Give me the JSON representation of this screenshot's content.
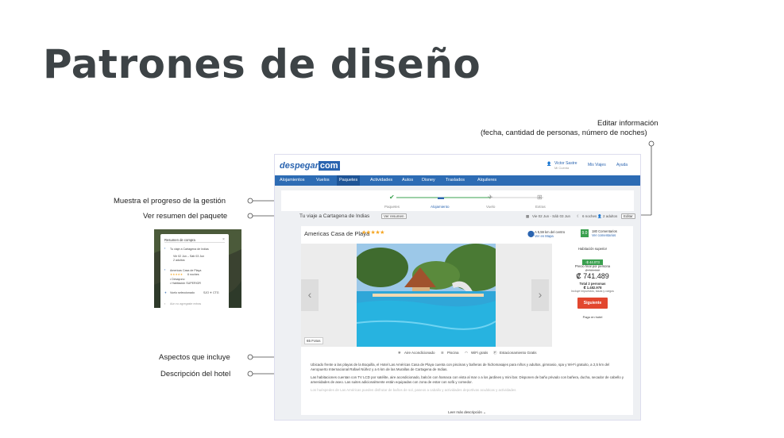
{
  "slide": {
    "title": "Patrones de diseño",
    "annotations": {
      "edit_line1": "Editar información",
      "edit_line2": "(fecha, cantidad de personas, número de noches)",
      "progress": "Muestra el progreso de la gestión",
      "summary": "Ver resumen del paquete",
      "amenities": "Aspectos que incluye",
      "description": "Descripción del hotel"
    }
  },
  "site": {
    "logo_main": "despegar",
    "logo_com": "com",
    "user_name": "Victor Sastre",
    "user_sub": "Mi Cuenta",
    "trips_link": "Mis Viajes",
    "help_link": "Ayuda",
    "nav": [
      "Alojamientos",
      "Vuelos",
      "Paquetes",
      "Actividades",
      "Autos",
      "Disney",
      "Traslados",
      "Alquileres"
    ],
    "steps": [
      "Paquetes",
      "Alojamiento",
      "Vuelo",
      "Extras"
    ],
    "trip_title": "Tu viaje a Cartagena de Indias",
    "summary_button": "Ver resumen",
    "dates": "Vie 02 Jun - Sáb 03 Jun",
    "nights": "6 noches",
    "adults": "2 adultos",
    "edit_button": "Editar"
  },
  "hotel": {
    "name": "Americas Casa de Playa",
    "stars": "★★★★★",
    "distance": "A 5,59 km del centro",
    "map_link": "Ver en Mapa",
    "score": "9.0",
    "reviews": "180 Comentarios",
    "reviews_link": "Ver comentarios",
    "photos": "65 Fotos",
    "room": "Habitación superior",
    "discount": "-$ 44.073",
    "price_label": "Precio final por persona",
    "old_price": "₡ 785.562",
    "price": "₡ 741.489",
    "total_label": "Total 2 personas",
    "total": "₡ 1.482.978",
    "taxes": "Incluye impuestos, tasas y cargos",
    "cta": "Siguiente",
    "hotel_pay": "Pago en hotel",
    "amenities": [
      "Aire Acondicionado",
      "Piscina",
      "WiFi gratis",
      "Estacionamiento Gratis"
    ],
    "desc1": "Ubicado frente a las playas de la Boquilla, el Hotel Las Américas Casa de Playa cuenta con piscinas y bañeras de hidromasajes para niños y adultos, gimnasio, spa y Wi-Fi gratuito, a 2,5 km del Aeropuerto Internacional Rafael Núñez y a 6 km de las Murallas de Cartagena de Indias.",
    "desc2": "Las habitaciones cuentan con TV LCD por satélite, aire acondicionado, balcón con hamaca con vista al mar o a los jardines y mini bar. Disponen de baño privado con bañera, ducha, secador de cabello y amenidades de aseo. Las suites adicionalmente están equipadas con zona de estar con sofá y comedor.",
    "desc3": "Los huéspedes de Las Américas pueden disfrutar de baños de sol, paseos a caballo y actividades deportivas acuáticas y actividades",
    "more": "Leer más descripción"
  },
  "summary_panel": {
    "title": "Resumen de compra",
    "trip": "Tu viaje a Cartagena de Indias",
    "dates": "Vie 02 Jun – Sáb 03 Jun",
    "adults": "2 adultos",
    "hotel": "Americas Casa de Playa",
    "stars": "★★★★★",
    "nights": "6 noches",
    "item1": "• Desayuno",
    "item2": "• Habitación SUPERIOR",
    "flight": "Vuelo seleccionado",
    "flight_route": "SJO ✈ CTG",
    "extras": "Aún no agregaste extras"
  },
  "colors": {
    "brand_blue": "#2d6cb4",
    "cta": "#e2472f",
    "discount": "#3aa04f",
    "title": "#3d4346"
  }
}
